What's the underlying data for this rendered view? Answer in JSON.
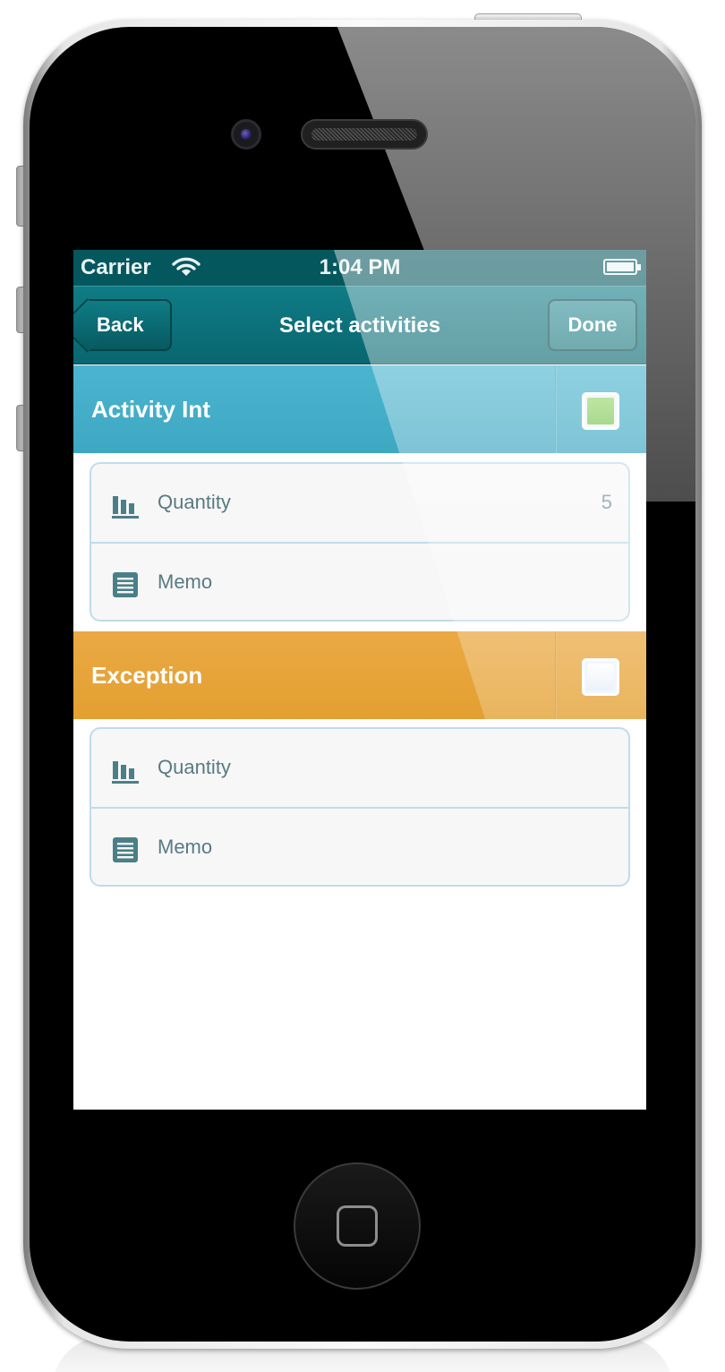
{
  "status_bar": {
    "carrier": "Carrier",
    "time": "1:04 PM",
    "wifi_icon": "wifi-icon",
    "battery_icon": "battery-icon"
  },
  "nav": {
    "back_label": "Back",
    "title": "Select activities",
    "done_label": "Done"
  },
  "colors": {
    "nav_background": "#0a6d76",
    "section_blue": "#45afcb",
    "section_orange": "#e8a63a",
    "checked_green": "#8ccf5f",
    "row_text": "#587a82"
  },
  "sections": [
    {
      "title": "Activity Int",
      "checked": true,
      "rows": [
        {
          "icon": "bar-chart-icon",
          "label": "Quantity",
          "value": "5"
        },
        {
          "icon": "list-icon",
          "label": "Memo",
          "value": ""
        }
      ]
    },
    {
      "title": "Exception",
      "checked": false,
      "rows": [
        {
          "icon": "bar-chart-icon",
          "label": "Quantity",
          "value": ""
        },
        {
          "icon": "list-icon",
          "label": "Memo",
          "value": ""
        }
      ]
    }
  ]
}
